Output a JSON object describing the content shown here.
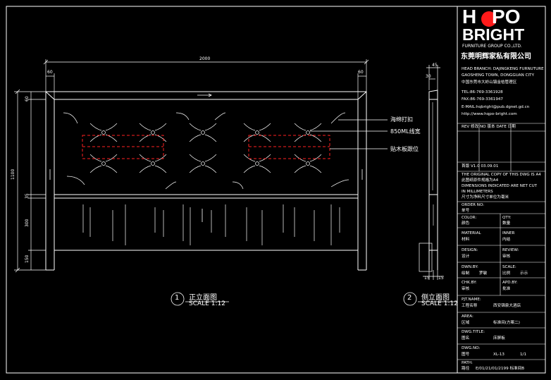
{
  "colors": {
    "background": "#000000",
    "line": "#ffffff",
    "red": "#ff2020",
    "logo_dot": "#ff1a1a"
  },
  "dimensions": {
    "total_width": "2000",
    "left_margin": "60",
    "right_margin": "60",
    "height": "1100",
    "top": "60",
    "mid": "35",
    "lower": "300",
    "bottom": "150",
    "side_depth": "45",
    "side_inner": "30",
    "side_bottom_left": "15",
    "side_bottom_right": "15"
  },
  "callouts": {
    "c1": "海绵打扣",
    "c2": "850ML线宽",
    "c3": "贴木板跟位"
  },
  "views": {
    "front_num": "1",
    "front_title": "正立面图",
    "front_scale": "SCALE 1:12",
    "side_num": "2",
    "side_title": "侧立面图",
    "side_scale": "SCALE 1:12"
  },
  "title_block": {
    "logo_h": "H",
    "logo_q": "Q",
    "logo_po": "PO",
    "logo_bright": "BRIGHT",
    "logo_sub": "FURNITURE GROUP CO.,LTD.",
    "company_cn": "东莞明辉家私有限公司",
    "addr1": "HEAD BRANCH: DAJINGKENG FURNUTURE",
    "addr2": "GAOSHENG TOWN, DONGGUAN CITY",
    "addr_cn": "中国东莞市大岭山镇金桔管理区",
    "tel": "TEL:86-769-3361928",
    "fax": "FAX:86-769-3361947",
    "email": "E-MAIL:hqbright@pub.dgnet.gd.cn",
    "web": "http://www.hqpo-bright.com",
    "rev_header": "REV  修改    NO 版本     DATE 日期",
    "rev_row": "首版         V1.0     03.09.01",
    "note1": "THE ORIGINAL COPY OF THIS DWG IS A4",
    "note2": "此图纸原件规格为A4",
    "note3": "DIMENSIONS INDICATED ARE NET CUT",
    "note4": "IN MILLIMETERS",
    "note5": "尺寸为净料尺寸单位为毫米",
    "order_no": "ORDER NO:",
    "order_cn": "单号",
    "color": "COLOR:",
    "color_cn": "颜色",
    "qty": "QTY:",
    "qty_cn": "数量",
    "material": "MATERIAL",
    "material_cn": "材料",
    "inner": "INNER",
    "inner_cn": "内结",
    "design": "DESIGN:",
    "design_cn": "设计",
    "review": "REVIEW:",
    "review_cn": "审核",
    "dwn": "DWN.BY:",
    "dwn_cn": "绘制",
    "dwn_name": "罗敏",
    "scale": "SCALE:",
    "scale_cn": "比例",
    "scale_val": "示示",
    "chk": "CHK.BY:",
    "chk_cn": "审核",
    "apd": "APD.BY:",
    "apd_cn": "批准",
    "prj": "PJT.NAME:",
    "prj_cn": "工程名称",
    "prj_val": "西安锦泉大酒店",
    "area": "AREA:",
    "area_cn": "区域",
    "area_val": "标准间(方案二)",
    "dwg_title": "DWG.TITLE:",
    "dwg_title_cn": "图名",
    "dwg_title_val": "床屏板",
    "dwg_no": "DWG.NO:",
    "dwg_no_cn": "图号",
    "dwg_no_val": "XL-13",
    "dwg_no_pg": "1/1",
    "path": "PATH:",
    "path_cn": "路径",
    "path_val": "E/01/21/01/2199 标准间B"
  }
}
